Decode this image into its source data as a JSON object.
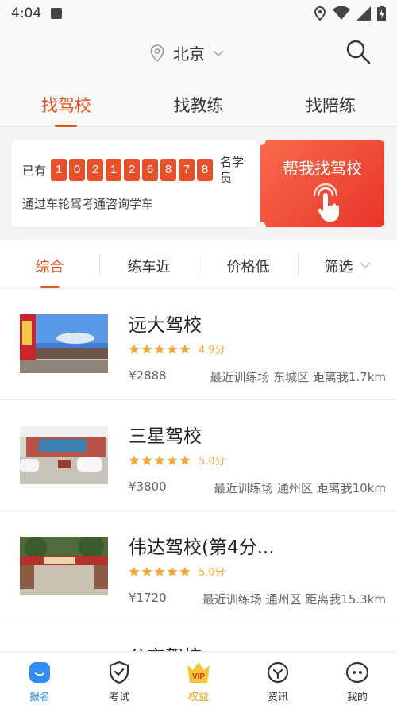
{
  "status_bar": {
    "time": "4:04"
  },
  "header": {
    "city": "北京"
  },
  "top_tabs": [
    {
      "label": "找驾校",
      "active": true
    },
    {
      "label": "找教练",
      "active": false
    },
    {
      "label": "找陪练",
      "active": false
    }
  ],
  "banner": {
    "prefix": "已有",
    "digits": [
      "1",
      "0",
      "2",
      "1",
      "2",
      "6",
      "8",
      "7",
      "8"
    ],
    "suffix": "名学员",
    "subtitle": "通过车轮驾考通咨询学车",
    "button_label": "帮我找驾校"
  },
  "filters": [
    {
      "label": "综合",
      "active": true
    },
    {
      "label": "练车近",
      "active": false
    },
    {
      "label": "价格低",
      "active": false
    },
    {
      "label": "筛选",
      "active": false
    }
  ],
  "schools": [
    {
      "name": "远大驾校",
      "score": "4.9分",
      "rating": 4.9,
      "price": "¥2888",
      "location": "最近训练场 东城区 距离我1.7km"
    },
    {
      "name": "三星驾校",
      "score": "5.0分",
      "rating": 5.0,
      "price": "¥3800",
      "location": "最近训练场 通州区 距离我10km"
    },
    {
      "name": "伟达驾校(第4分...",
      "score": "5.0分",
      "rating": 5.0,
      "price": "¥1720",
      "location": "最近训练场 通州区 距离我15.3km"
    },
    {
      "name": "公交驾校"
    }
  ],
  "bottom_nav": [
    {
      "label": "报名",
      "icon": "signup-icon",
      "active": true
    },
    {
      "label": "考试",
      "icon": "exam-shield-icon",
      "active": false
    },
    {
      "label": "权益",
      "icon": "vip-crown-icon",
      "active": false
    },
    {
      "label": "资讯",
      "icon": "news-icon",
      "active": false
    },
    {
      "label": "我的",
      "icon": "profile-icon",
      "active": false
    }
  ],
  "colors": {
    "accent": "#e5531d",
    "digit_bg": "#e8502a",
    "star": "#f3a63b",
    "nav_active": "#2f8df4",
    "vip": "#e8a11a"
  }
}
